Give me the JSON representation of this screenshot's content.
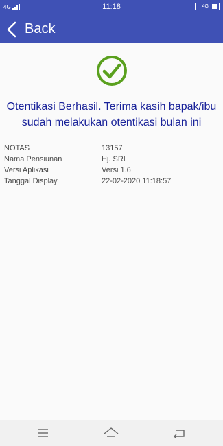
{
  "status_bar": {
    "network": "4G",
    "time": "11:18",
    "right_network": "4G",
    "icons": [
      "signal-icon",
      "vibrate-icon",
      "battery-icon"
    ]
  },
  "app_bar": {
    "back_label": "Back",
    "icon": "chevron-left-icon"
  },
  "success": {
    "icon": "check-circle-icon",
    "message": "Otentikasi Berhasil. Terima kasih bapak/ibu sudah melakukan otentikasi bulan ini"
  },
  "details": [
    {
      "label": "NOTAS",
      "value": "13157"
    },
    {
      "label": "Nama Pensiunan",
      "value": "Hj. SRI"
    },
    {
      "label": "Versi Aplikasi",
      "value": "Versi 1.6"
    },
    {
      "label": "Tanggal Display",
      "value": "22-02-2020 11:18:57"
    }
  ],
  "nav_bar": {
    "icons": [
      "menu-icon",
      "home-icon",
      "back-icon"
    ]
  },
  "colors": {
    "primary": "#3f51b5",
    "message_text": "#1a239a",
    "check_green": "#5aa01e",
    "background": "#fafafa"
  }
}
